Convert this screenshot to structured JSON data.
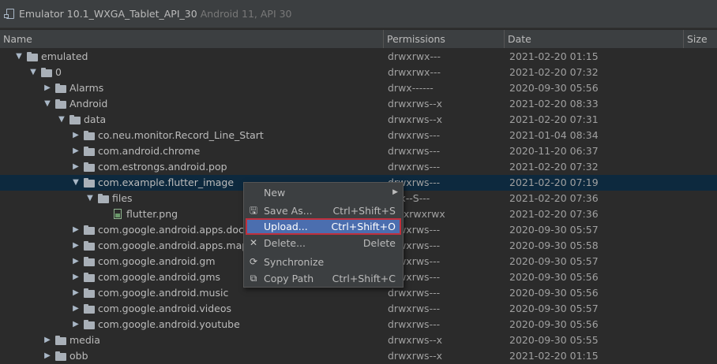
{
  "window": {
    "title": "Emulator 10.1_WXGA_Tablet_API_30",
    "subtitle": "Android 11, API 30"
  },
  "columns": {
    "name": "Name",
    "permissions": "Permissions",
    "date": "Date",
    "size": "Size"
  },
  "rows": [
    {
      "name": "emulated",
      "perm": "drwxrwx---",
      "date": "2021-02-20 01:15"
    },
    {
      "name": "0",
      "perm": "drwxrwx---",
      "date": "2021-02-20 07:32"
    },
    {
      "name": "Alarms",
      "perm": "drwx------",
      "date": "2020-09-30 05:56"
    },
    {
      "name": "Android",
      "perm": "drwxrws--x",
      "date": "2021-02-20 08:33"
    },
    {
      "name": "data",
      "perm": "drwxrws--x",
      "date": "2021-02-20 07:31"
    },
    {
      "name": "co.neu.monitor.Record_Line_Start",
      "perm": "drwxrws---",
      "date": "2021-01-04 08:34"
    },
    {
      "name": "com.android.chrome",
      "perm": "drwxrws---",
      "date": "2020-11-20 06:37"
    },
    {
      "name": "com.estrongs.android.pop",
      "perm": "drwxrws---",
      "date": "2021-02-20 07:32"
    },
    {
      "name": "com.example.flutter_image",
      "perm": "drwxrws---",
      "date": "2021-02-20 07:19"
    },
    {
      "name": "files",
      "perm": "rwx--S---",
      "date": "2021-02-20 07:36"
    },
    {
      "name": "flutter.png",
      "perm": "-rwxrwxrwx",
      "date": "2021-02-20 07:36"
    },
    {
      "name": "com.google.android.apps.docs",
      "perm": "drwxrws---",
      "date": "2020-09-30 05:57"
    },
    {
      "name": "com.google.android.apps.maps",
      "perm": "drwxrws---",
      "date": "2020-09-30 05:58"
    },
    {
      "name": "com.google.android.gm",
      "perm": "drwxrws---",
      "date": "2020-09-30 05:57"
    },
    {
      "name": "com.google.android.gms",
      "perm": "drwxrws---",
      "date": "2020-09-30 05:56"
    },
    {
      "name": "com.google.android.music",
      "perm": "drwxrws---",
      "date": "2020-09-30 05:56"
    },
    {
      "name": "com.google.android.videos",
      "perm": "drwxrws---",
      "date": "2020-09-30 05:57"
    },
    {
      "name": "com.google.android.youtube",
      "perm": "drwxrws---",
      "date": "2020-09-30 05:56"
    },
    {
      "name": "media",
      "perm": "drwxrws--x",
      "date": "2020-09-30 05:55"
    },
    {
      "name": "obb",
      "perm": "drwxrws--x",
      "date": "2021-02-20 01:15"
    }
  ],
  "context_menu": {
    "new": "New",
    "save_as": "Save As...",
    "save_as_shortcut": "Ctrl+Shift+S",
    "upload": "Upload...",
    "upload_shortcut": "Ctrl+Shift+O",
    "delete": "Delete...",
    "delete_shortcut": "Delete",
    "synchronize": "Synchronize",
    "copy_path": "Copy Path",
    "copy_path_shortcut": "Ctrl+Shift+C"
  },
  "colors": {
    "background": "#2b2b2b",
    "selection": "#0d293e",
    "menu_highlight": "#4b6eaf",
    "highlight_border": "#c0303d"
  }
}
